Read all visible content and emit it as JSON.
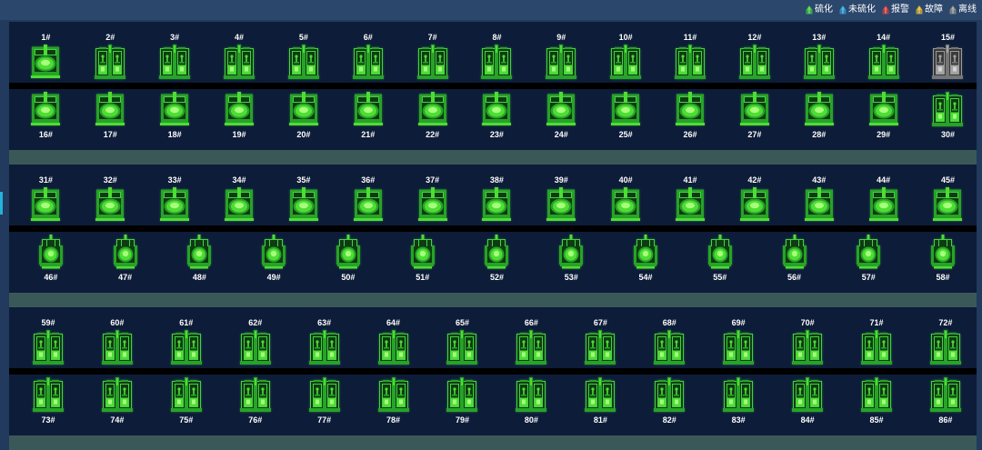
{
  "legend": [
    {
      "label": "硫化",
      "color": "#3cc83c",
      "icon": "press-mini"
    },
    {
      "label": "未硫化",
      "color": "#2a9ad6",
      "icon": "press-mini"
    },
    {
      "label": "报警",
      "color": "#d73a3a",
      "icon": "press-mini"
    },
    {
      "label": "故障",
      "color": "#d8b12a",
      "icon": "press-mini"
    },
    {
      "label": "离线",
      "color": "#8e8e8e",
      "icon": "press-mini"
    }
  ],
  "zones": [
    {
      "rows": [
        {
          "machines": [
            {
              "label": "1#",
              "icon": "press-closed",
              "color": "#3cc83c"
            },
            {
              "label": "2#",
              "icon": "press-open-double",
              "color": "#3cc83c"
            },
            {
              "label": "3#",
              "icon": "press-open-double",
              "color": "#3cc83c"
            },
            {
              "label": "4#",
              "icon": "press-open-double",
              "color": "#3cc83c"
            },
            {
              "label": "5#",
              "icon": "press-open-double",
              "color": "#3cc83c"
            },
            {
              "label": "6#",
              "icon": "press-open-double",
              "color": "#3cc83c"
            },
            {
              "label": "7#",
              "icon": "press-open-double",
              "color": "#3cc83c"
            },
            {
              "label": "8#",
              "icon": "press-open-double",
              "color": "#3cc83c"
            },
            {
              "label": "9#",
              "icon": "press-open-double",
              "color": "#3cc83c"
            },
            {
              "label": "10#",
              "icon": "press-open-double",
              "color": "#3cc83c"
            },
            {
              "label": "11#",
              "icon": "press-open-double",
              "color": "#3cc83c"
            },
            {
              "label": "12#",
              "icon": "press-open-double",
              "color": "#3cc83c"
            },
            {
              "label": "13#",
              "icon": "press-open-double",
              "color": "#3cc83c"
            },
            {
              "label": "14#",
              "icon": "press-open-double",
              "color": "#3cc83c"
            },
            {
              "label": "15#",
              "icon": "press-open-double",
              "color": "#8e8e8e"
            }
          ]
        },
        {
          "machines": [
            {
              "label": "16#",
              "icon": "press-closed",
              "color": "#3cc83c"
            },
            {
              "label": "17#",
              "icon": "press-closed",
              "color": "#3cc83c"
            },
            {
              "label": "18#",
              "icon": "press-closed",
              "color": "#3cc83c"
            },
            {
              "label": "19#",
              "icon": "press-closed",
              "color": "#3cc83c"
            },
            {
              "label": "20#",
              "icon": "press-closed",
              "color": "#3cc83c"
            },
            {
              "label": "21#",
              "icon": "press-closed",
              "color": "#3cc83c"
            },
            {
              "label": "22#",
              "icon": "press-closed",
              "color": "#3cc83c"
            },
            {
              "label": "23#",
              "icon": "press-closed",
              "color": "#3cc83c"
            },
            {
              "label": "24#",
              "icon": "press-closed",
              "color": "#3cc83c"
            },
            {
              "label": "25#",
              "icon": "press-closed",
              "color": "#3cc83c"
            },
            {
              "label": "26#",
              "icon": "press-closed",
              "color": "#3cc83c"
            },
            {
              "label": "27#",
              "icon": "press-closed",
              "color": "#3cc83c"
            },
            {
              "label": "28#",
              "icon": "press-closed",
              "color": "#3cc83c"
            },
            {
              "label": "29#",
              "icon": "press-closed",
              "color": "#3cc83c"
            },
            {
              "label": "30#",
              "icon": "press-open-double",
              "color": "#3cc83c"
            }
          ]
        }
      ]
    },
    {
      "rows": [
        {
          "machines": [
            {
              "label": "31#",
              "icon": "press-closed",
              "color": "#3cc83c"
            },
            {
              "label": "32#",
              "icon": "press-closed",
              "color": "#3cc83c"
            },
            {
              "label": "33#",
              "icon": "press-closed",
              "color": "#3cc83c"
            },
            {
              "label": "34#",
              "icon": "press-closed",
              "color": "#3cc83c"
            },
            {
              "label": "35#",
              "icon": "press-closed",
              "color": "#3cc83c"
            },
            {
              "label": "36#",
              "icon": "press-closed",
              "color": "#3cc83c"
            },
            {
              "label": "37#",
              "icon": "press-closed",
              "color": "#3cc83c"
            },
            {
              "label": "38#",
              "icon": "press-closed",
              "color": "#3cc83c"
            },
            {
              "label": "39#",
              "icon": "press-closed",
              "color": "#3cc83c"
            },
            {
              "label": "40#",
              "icon": "press-closed",
              "color": "#3cc83c"
            },
            {
              "label": "41#",
              "icon": "press-closed",
              "color": "#3cc83c"
            },
            {
              "label": "42#",
              "icon": "press-closed",
              "color": "#3cc83c"
            },
            {
              "label": "43#",
              "icon": "press-closed",
              "color": "#3cc83c"
            },
            {
              "label": "44#",
              "icon": "press-closed",
              "color": "#3cc83c"
            },
            {
              "label": "45#",
              "icon": "press-closed",
              "color": "#3cc83c"
            }
          ]
        },
        {
          "machines": [
            {
              "label": "46#",
              "icon": "press-tall",
              "color": "#3cc83c"
            },
            {
              "label": "47#",
              "icon": "press-tall",
              "color": "#3cc83c"
            },
            {
              "label": "48#",
              "icon": "press-tall",
              "color": "#3cc83c"
            },
            {
              "label": "49#",
              "icon": "press-tall",
              "color": "#3cc83c"
            },
            {
              "label": "50#",
              "icon": "press-tall",
              "color": "#3cc83c"
            },
            {
              "label": "51#",
              "icon": "press-tall",
              "color": "#3cc83c"
            },
            {
              "label": "52#",
              "icon": "press-tall",
              "color": "#3cc83c"
            },
            {
              "label": "53#",
              "icon": "press-tall",
              "color": "#3cc83c"
            },
            {
              "label": "54#",
              "icon": "press-tall",
              "color": "#3cc83c"
            },
            {
              "label": "55#",
              "icon": "press-tall",
              "color": "#3cc83c"
            },
            {
              "label": "56#",
              "icon": "press-tall",
              "color": "#3cc83c"
            },
            {
              "label": "57#",
              "icon": "press-tall",
              "color": "#3cc83c"
            },
            {
              "label": "58#",
              "icon": "press-tall",
              "color": "#3cc83c"
            }
          ]
        }
      ]
    },
    {
      "rows": [
        {
          "machines": [
            {
              "label": "59#",
              "icon": "press-open-double",
              "color": "#3cc83c"
            },
            {
              "label": "60#",
              "icon": "press-open-double",
              "color": "#3cc83c"
            },
            {
              "label": "61#",
              "icon": "press-open-double",
              "color": "#3cc83c"
            },
            {
              "label": "62#",
              "icon": "press-open-double",
              "color": "#3cc83c"
            },
            {
              "label": "63#",
              "icon": "press-open-double",
              "color": "#3cc83c"
            },
            {
              "label": "64#",
              "icon": "press-open-double",
              "color": "#3cc83c"
            },
            {
              "label": "65#",
              "icon": "press-open-double",
              "color": "#3cc83c"
            },
            {
              "label": "66#",
              "icon": "press-open-double",
              "color": "#3cc83c"
            },
            {
              "label": "67#",
              "icon": "press-open-double",
              "color": "#3cc83c"
            },
            {
              "label": "68#",
              "icon": "press-open-double",
              "color": "#3cc83c"
            },
            {
              "label": "69#",
              "icon": "press-open-double",
              "color": "#3cc83c"
            },
            {
              "label": "70#",
              "icon": "press-open-double",
              "color": "#3cc83c"
            },
            {
              "label": "71#",
              "icon": "press-open-double",
              "color": "#3cc83c"
            },
            {
              "label": "72#",
              "icon": "press-open-double",
              "color": "#3cc83c"
            }
          ]
        },
        {
          "machines": [
            {
              "label": "73#",
              "icon": "press-open-double",
              "color": "#3cc83c"
            },
            {
              "label": "74#",
              "icon": "press-open-double",
              "color": "#3cc83c"
            },
            {
              "label": "75#",
              "icon": "press-open-double",
              "color": "#3cc83c"
            },
            {
              "label": "76#",
              "icon": "press-open-double",
              "color": "#3cc83c"
            },
            {
              "label": "77#",
              "icon": "press-open-double",
              "color": "#3cc83c"
            },
            {
              "label": "78#",
              "icon": "press-open-double",
              "color": "#3cc83c"
            },
            {
              "label": "79#",
              "icon": "press-open-double",
              "color": "#3cc83c"
            },
            {
              "label": "80#",
              "icon": "press-open-double",
              "color": "#3cc83c"
            },
            {
              "label": "81#",
              "icon": "press-open-double",
              "color": "#3cc83c"
            },
            {
              "label": "82#",
              "icon": "press-open-double",
              "color": "#3cc83c"
            },
            {
              "label": "83#",
              "icon": "press-open-double",
              "color": "#3cc83c"
            },
            {
              "label": "84#",
              "icon": "press-open-double",
              "color": "#3cc83c"
            },
            {
              "label": "85#",
              "icon": "press-open-double",
              "color": "#3cc83c"
            },
            {
              "label": "86#",
              "icon": "press-open-double",
              "color": "#3cc83c"
            }
          ]
        }
      ]
    }
  ]
}
